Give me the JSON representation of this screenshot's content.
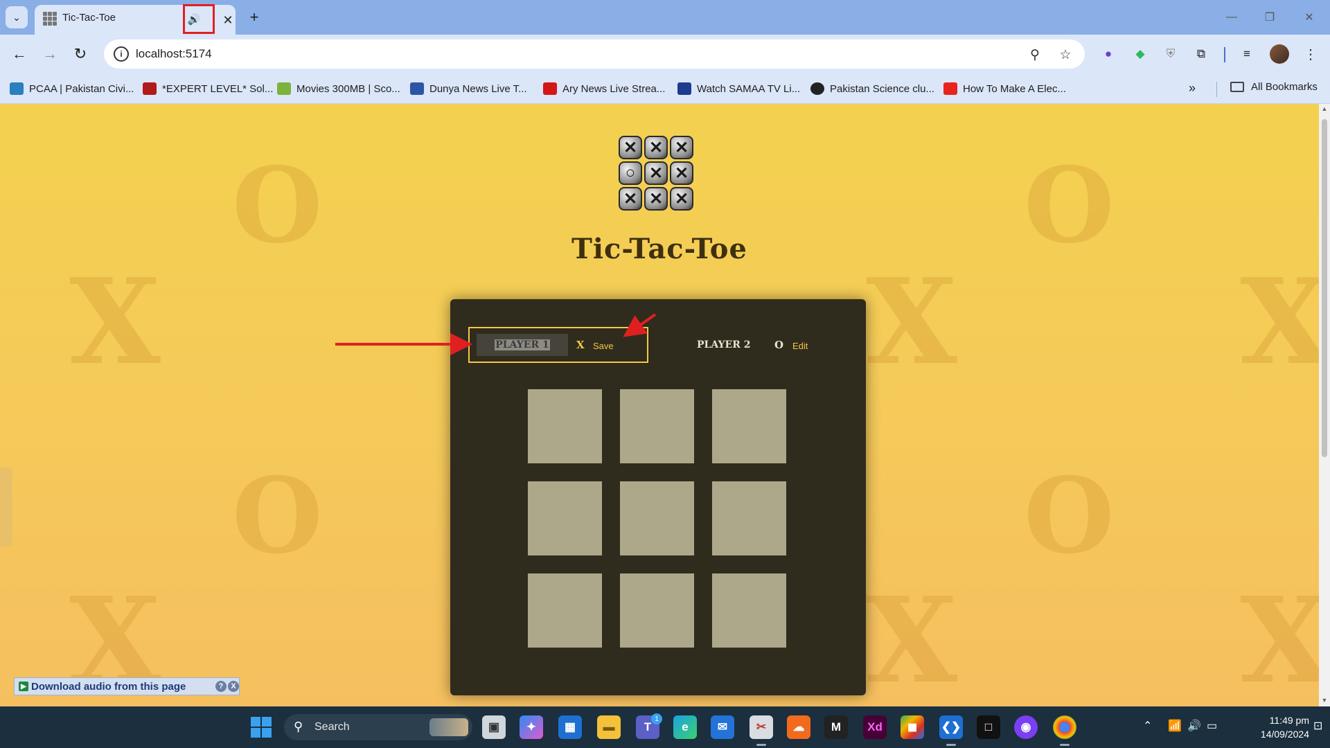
{
  "browser": {
    "tab_title": "Tic-Tac-Toe",
    "tab_close": "✕",
    "new_tab": "+",
    "url": "localhost:5174",
    "window_controls": [
      "—",
      "❐",
      "✕"
    ]
  },
  "bookmarks": [
    {
      "label": "PCAA | Pakistan Civi...",
      "color": "#2a7fbf"
    },
    {
      "label": "*EXPERT LEVEL* Sol...",
      "color": "#b01a1a"
    },
    {
      "label": "Movies 300MB | Sco...",
      "color": "#7cb33a"
    },
    {
      "label": "Dunya News Live T...",
      "color": "#2b56a6"
    },
    {
      "label": "Ary News Live Strea...",
      "color": "#d41616"
    },
    {
      "label": "Watch SAMAA TV Li...",
      "color": "#1d3c8f"
    },
    {
      "label": "Pakistan Science clu...",
      "color": "#222222"
    },
    {
      "label": "How To Make A Elec...",
      "color": "#e8231f"
    }
  ],
  "bookmarks_more": "»",
  "bookmarks_all": "All Bookmarks",
  "game": {
    "title": "Tic-Tac-Toe",
    "player1": {
      "value": "PLAYER 1",
      "symbol": "X",
      "action": "Save"
    },
    "player2": {
      "name": "PLAYER 2",
      "symbol": "O",
      "action": "Edit"
    },
    "board": [
      "",
      "",
      "",
      "",
      "",
      "",
      "",
      "",
      ""
    ]
  },
  "logo_cells": [
    "✕",
    "✕",
    "✕",
    "○",
    "✕",
    "✕",
    "✕",
    "✕",
    "✕"
  ],
  "download_bar": {
    "label": "Download audio from this page",
    "help": "?",
    "close": "X"
  },
  "taskbar": {
    "search_label": "Search",
    "teams_badge": "1",
    "time": "11:49 pm",
    "date": "14/09/2024"
  },
  "colors": {
    "accent": "#f6c744",
    "panel": "#2f2c1e",
    "cell": "#aea88a",
    "annotation": "#e02020"
  }
}
